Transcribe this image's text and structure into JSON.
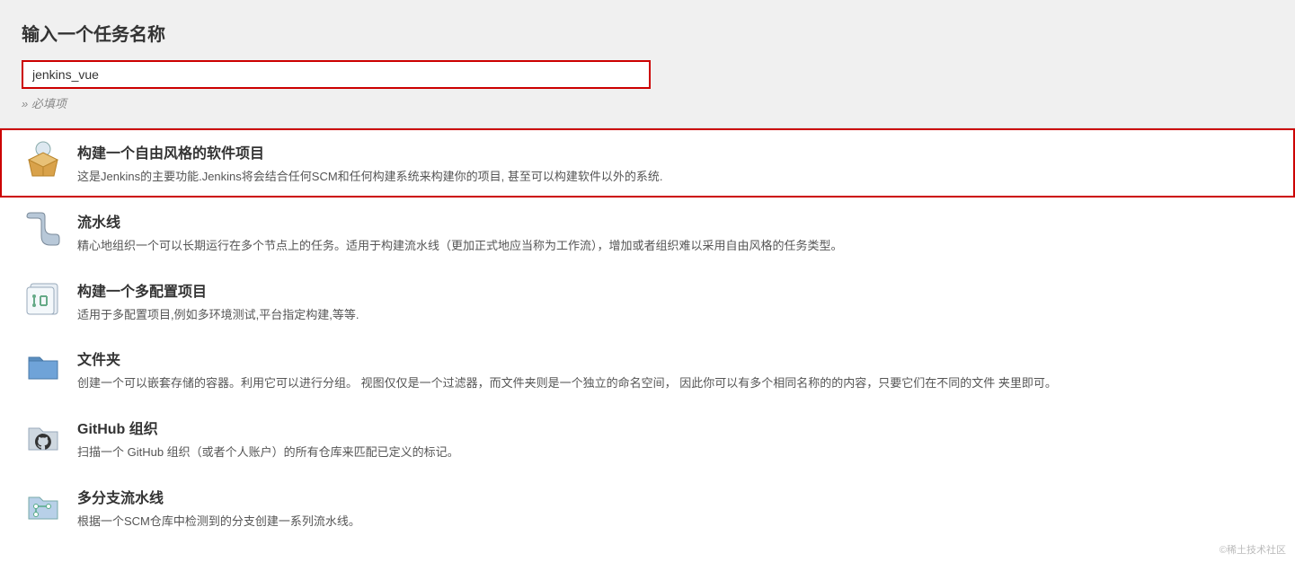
{
  "header": {
    "title": "输入一个任务名称",
    "name_value": "jenkins_vue",
    "required_note": "» 必填项"
  },
  "items": [
    {
      "id": "freestyle",
      "title": "构建一个自由风格的软件项目",
      "desc": "这是Jenkins的主要功能.Jenkins将会结合任何SCM和任何构建系统来构建你的项目, 甚至可以构建软件以外的系统.",
      "highlighted": true
    },
    {
      "id": "pipeline",
      "title": "流水线",
      "desc": "精心地组织一个可以长期运行在多个节点上的任务。适用于构建流水线（更加正式地应当称为工作流），增加或者组织难以采用自由风格的任务类型。",
      "highlighted": false
    },
    {
      "id": "multiconfig",
      "title": "构建一个多配置项目",
      "desc": "适用于多配置项目,例如多环境测试,平台指定构建,等等.",
      "highlighted": false
    },
    {
      "id": "folder",
      "title": "文件夹",
      "desc": "创建一个可以嵌套存储的容器。利用它可以进行分组。 视图仅仅是一个过滤器，而文件夹则是一个独立的命名空间， 因此你可以有多个相同名称的的内容，只要它们在不同的文件 夹里即可。",
      "highlighted": false
    },
    {
      "id": "github-org",
      "title": "GitHub 组织",
      "desc": "扫描一个 GitHub 组织（或者个人账户）的所有仓库来匹配已定义的标记。",
      "highlighted": false
    },
    {
      "id": "multibranch",
      "title": "多分支流水线",
      "desc": "根据一个SCM仓库中检测到的分支创建一系列流水线。",
      "highlighted": false
    }
  ],
  "watermark": "©稀土技术社区"
}
